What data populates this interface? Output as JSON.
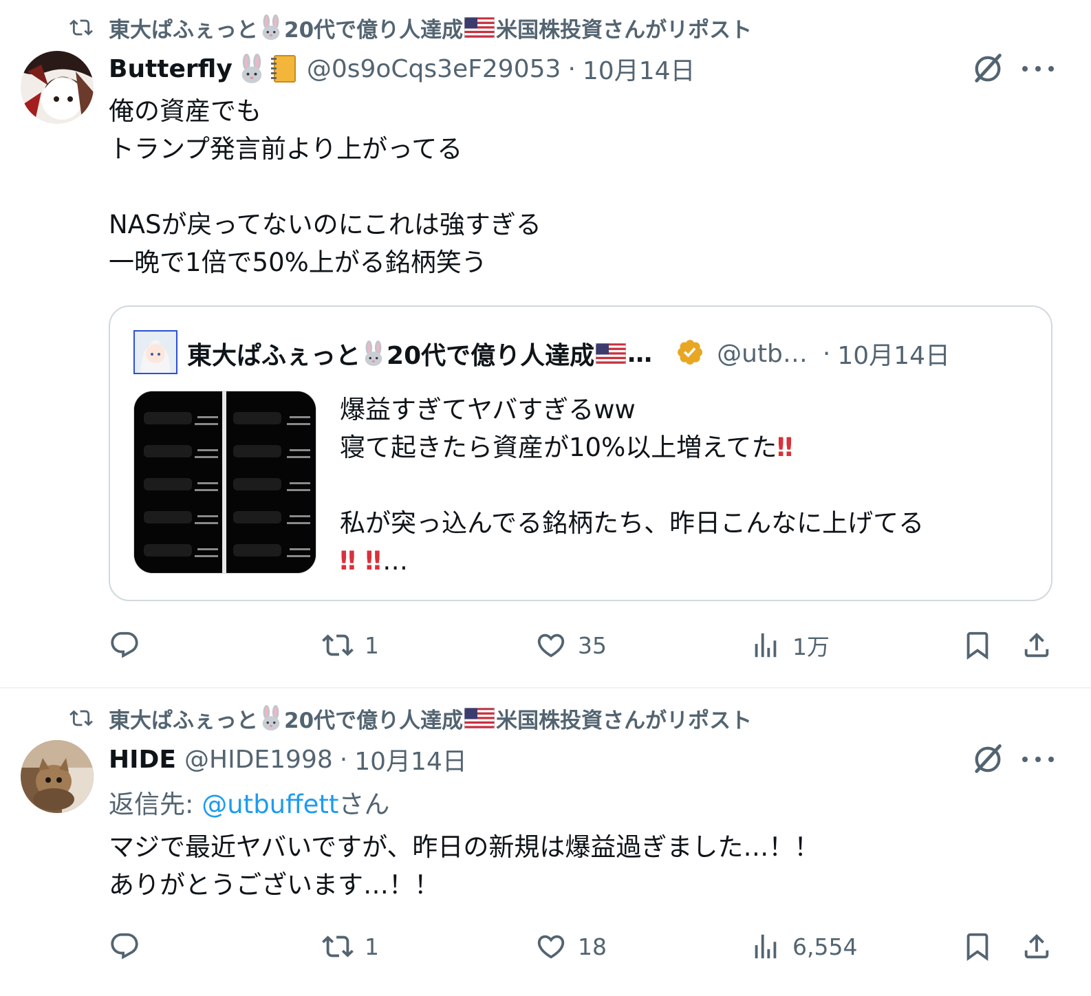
{
  "posts": [
    {
      "repost_text": "東大ぱふぇっと🐰20代で億り人達成🇺🇸米国株投資さんがリポスト",
      "repost_parts": [
        "東大ぱふぇっと",
        "20代で億り人達成",
        "米国株投資さんがリポスト"
      ],
      "author_name": "Butterfly",
      "handle": "@0s9oCqs3eF29053",
      "separator": "·",
      "time": "10月14日",
      "body": "俺の資産でも\nトランプ発言前より上がってる\n\nNASが戻ってないのにこれは強すぎる\n一晩で1倍で50%上がる銘柄笑う",
      "quote": {
        "author_parts": [
          "東大ぱふぇっと",
          "20代で億り人達成"
        ],
        "ellipsis": "…",
        "handle": "@utb…",
        "separator": "·",
        "time": "10月14日",
        "text": "爆益すぎてヤバすぎるww\n寝て起きたら資産が10%以上増えてた",
        "text2": "\n\n私が突っ込んでる銘柄たち、昨日こんなに上げてる",
        "bang": "‼",
        "trail": "…"
      },
      "counts": {
        "reply": "",
        "repost": "1",
        "like": "35",
        "views": "1万"
      }
    },
    {
      "repost_parts": [
        "東大ぱふぇっと",
        "20代で億り人達成",
        "米国株投資さんがリポスト"
      ],
      "author_name": "HIDE",
      "handle": "@HIDE1998",
      "separator": "·",
      "time": "10月14日",
      "reply_label": "返信先: ",
      "reply_handle": "@utbuffett",
      "reply_suffix": "さん",
      "body": "マジで最近ヤバいですが、昨日の新規は爆益過ぎました…！！\nありがとうございます…！！",
      "counts": {
        "reply": "",
        "repost": "1",
        "like": "18",
        "views": "6,554"
      }
    }
  ],
  "icons": {
    "repost": "repost-icon",
    "reply": "reply-icon",
    "like": "heart-icon",
    "views": "views-chart-icon",
    "bookmark": "bookmark-icon",
    "share": "share-icon",
    "grok": "grok-icon",
    "more": "more-icon",
    "verified": "verified-badge-icon"
  },
  "colors": {
    "text": "#0f1419",
    "secondary": "#536471",
    "link": "#1d9bf0",
    "border": "#cfd9de",
    "verified": "#e8a723",
    "bang": "#d9313a"
  }
}
